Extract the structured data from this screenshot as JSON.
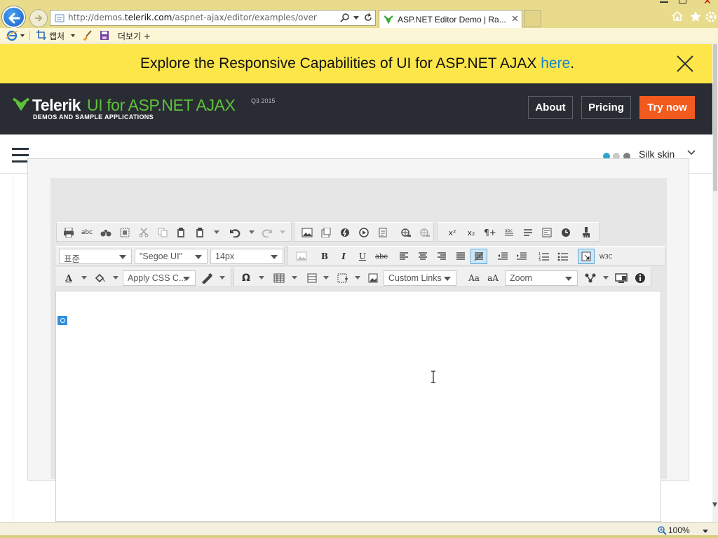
{
  "browser": {
    "url_prefix": "http://demos.",
    "url_domain": "telerik.com",
    "url_rest": "/aspnet-ajax/editor/examples/overview/defa",
    "tab_title": "ASP.NET Editor Demo | Ra...",
    "tab_close": "✕",
    "command_bar": {
      "capture_label": "캡처",
      "more_label": "더보기 +"
    },
    "zoom": "100%"
  },
  "promo": {
    "text": "Explore the Responsive Capabilities of UI for ASP.NET AJAX ",
    "link": "here",
    "period": "."
  },
  "header": {
    "logo_name": "Telerik",
    "logo_product": "UI for ASP.NET AJAX",
    "logo_version": "Q3 2015",
    "logo_sub": "DEMOS AND SAMPLE APPLICATIONS",
    "about_label": "About",
    "pricing_label": "Pricing",
    "trynow_label": "Try now",
    "colors": {
      "header_bg": "#292d33",
      "brand_green": "#5ec23b",
      "try_now": "#f35a1e",
      "banner_bg": "#fde64a"
    }
  },
  "subnav": {
    "skin_label": "Silk skin",
    "skin_dot_colors": [
      "#2fa4cf",
      "#c9c9c9",
      "#7f7f7f"
    ]
  },
  "editor": {
    "paragraph_style": "표준",
    "font_name": "\"Segoe UI\"",
    "font_size": "14px",
    "css_class": "Apply CSS C...",
    "custom_links": "Custom Links",
    "zoom": "Zoom",
    "bold": "B",
    "italic": "I",
    "underline": "U",
    "strike": "abc",
    "font_color": "A",
    "case_upper": "Aa",
    "case_lower": "aA",
    "omega": "Ω",
    "superscript": "x²",
    "subscript": "x₂",
    "pilcrow": "¶+"
  }
}
